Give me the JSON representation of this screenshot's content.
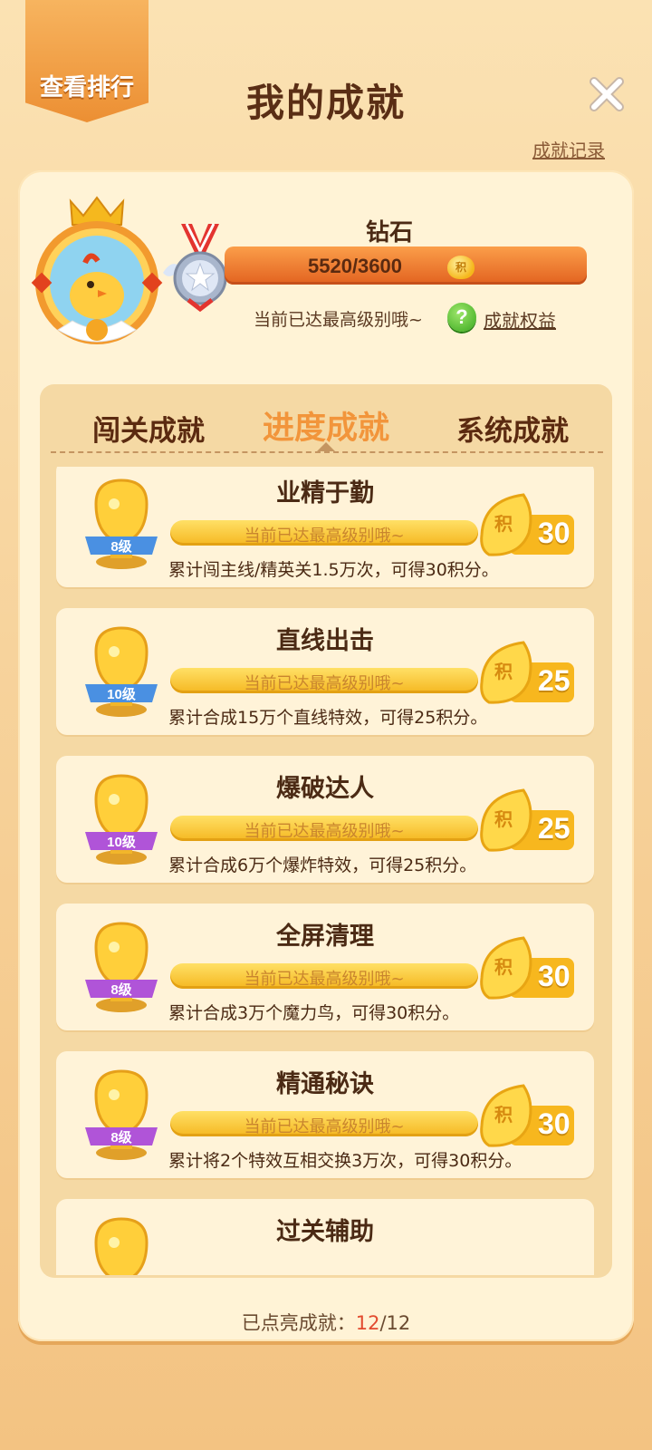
{
  "header": {
    "rank_button": "查看排行",
    "title": "我的成就",
    "close": "✕",
    "records_link": "成就记录"
  },
  "summary": {
    "tier": "钻石",
    "progress_text": "5520/3600",
    "progress_fraction": 1.0,
    "points_icon_char": "积",
    "max_level_text": "当前已达最高级别哦~",
    "help_char": "?",
    "benefits_link": "成就权益"
  },
  "tabs": {
    "a": "闯关成就",
    "b": "进度成就",
    "c": "系统成就",
    "active": "b"
  },
  "achievements": [
    {
      "title": "业精于勤",
      "level": "8级",
      "status": "当前已达最高级别哦~",
      "reward_char": "积",
      "reward": "30",
      "desc": "累计闯主线/精英关1.5万次，可得30积分。",
      "ribbon_color": "#4a90e2"
    },
    {
      "title": "直线出击",
      "level": "10级",
      "status": "当前已达最高级别哦~",
      "reward_char": "积",
      "reward": "25",
      "desc": "累计合成15万个直线特效，可得25积分。",
      "ribbon_color": "#4a90e2"
    },
    {
      "title": "爆破达人",
      "level": "10级",
      "status": "当前已达最高级别哦~",
      "reward_char": "积",
      "reward": "25",
      "desc": "累计合成6万个爆炸特效，可得25积分。",
      "ribbon_color": "#b054d8"
    },
    {
      "title": "全屏清理",
      "level": "8级",
      "status": "当前已达最高级别哦~",
      "reward_char": "积",
      "reward": "30",
      "desc": "累计合成3万个魔力鸟，可得30积分。",
      "ribbon_color": "#b054d8"
    },
    {
      "title": "精通秘诀",
      "level": "8级",
      "status": "当前已达最高级别哦~",
      "reward_char": "积",
      "reward": "30",
      "desc": "累计将2个特效互相交换3万次，可得30积分。",
      "ribbon_color": "#b054d8"
    },
    {
      "title": "过关辅助",
      "level": "",
      "status": "",
      "reward_char": "",
      "reward": "",
      "desc": "",
      "ribbon_color": "#e24a2e"
    }
  ],
  "footer": {
    "lit_label": "已点亮成就：",
    "lit_current": "12",
    "lit_total": "/12"
  }
}
